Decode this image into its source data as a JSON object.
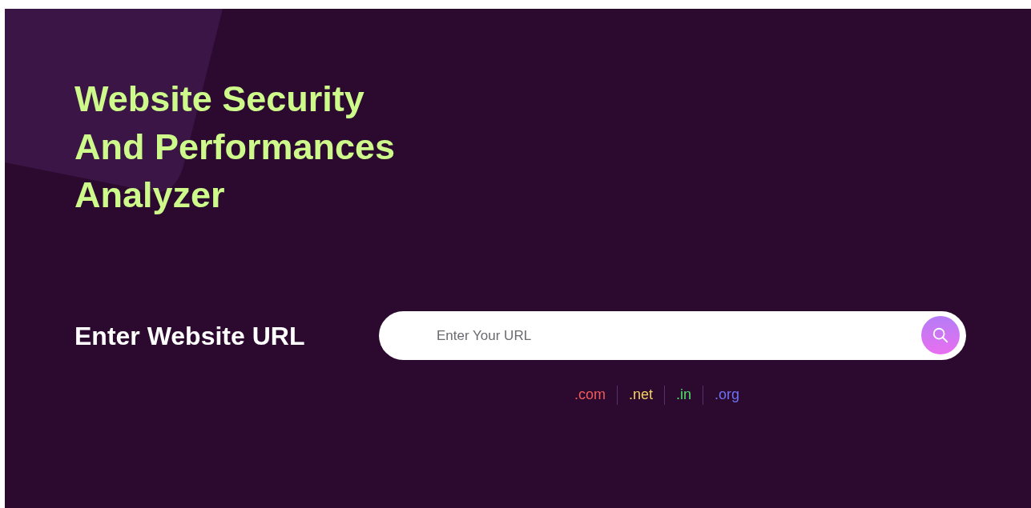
{
  "hero": {
    "title_lines": [
      "Website Security",
      "And Performances",
      "Analyzer"
    ]
  },
  "url_form": {
    "label": "Enter Website URL",
    "placeholder": "Enter Your URL"
  },
  "domains": [
    {
      "label": ".com",
      "color": "#f05a5a"
    },
    {
      "label": ".net",
      "color": "#f5d35f"
    },
    {
      "label": ".in",
      "color": "#4ee06a"
    },
    {
      "label": ".org",
      "color": "#6d72f0"
    }
  ]
}
